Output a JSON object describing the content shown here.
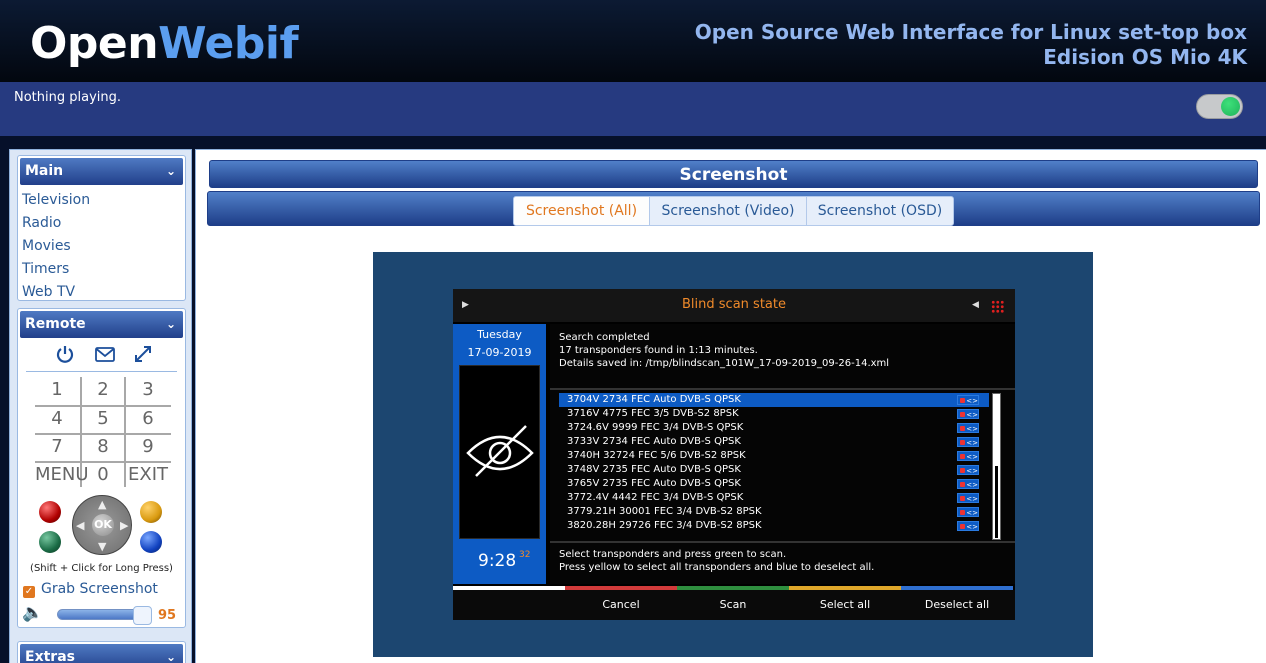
{
  "header": {
    "logo_part1": "Open",
    "logo_part2": "Webif",
    "subtitle_line1": "Open Source Web Interface for Linux set-top box",
    "subtitle_line2": "Edision OS Mio 4K"
  },
  "status": {
    "now_playing": "Nothing playing.",
    "toggle_on": true,
    "toggle_color": "#1eb35a"
  },
  "sidebar": {
    "main": {
      "title": "Main",
      "items": [
        "Television",
        "Radio",
        "Movies",
        "Timers",
        "Web TV"
      ]
    },
    "remote": {
      "title": "Remote",
      "icons": [
        "power-icon",
        "envelope-icon",
        "expand-icon"
      ],
      "keys": [
        "1",
        "2",
        "3",
        "4",
        "5",
        "6",
        "7",
        "8",
        "9",
        "MENU",
        "0",
        "EXIT"
      ],
      "ok_label": "OK",
      "long_press_hint": "(Shift + Click for Long Press)",
      "grab_screenshot_label": "Grab Screenshot",
      "grab_screenshot_checked": true,
      "volume": "95"
    },
    "extras": {
      "title": "Extras"
    }
  },
  "content": {
    "title": "Screenshot",
    "tabs": [
      "Screenshot (All)",
      "Screenshot (Video)",
      "Screenshot (OSD)"
    ],
    "active_tab": "Screenshot (All)"
  },
  "screenshot": {
    "title": "Blind scan state",
    "day": "Tuesday",
    "date": "17-09-2019",
    "time": "9:28",
    "seconds": "32",
    "messages": [
      "Search completed",
      "17 transponders found in 1:13 minutes.",
      "Details saved in: /tmp/blindscan_101W_17-09-2019_09-26-14.xml"
    ],
    "transponders": [
      "3704V 2734 FEC Auto DVB-S QPSK",
      "3716V 4775 FEC 3/5 DVB-S2 8PSK",
      "3724.6V 9999 FEC 3/4 DVB-S QPSK",
      "3733V 2734 FEC Auto DVB-S QPSK",
      "3740H 32724 FEC 5/6 DVB-S2 8PSK",
      "3748V 2735 FEC Auto DVB-S QPSK",
      "3765V 2735 FEC Auto DVB-S QPSK",
      "3772.4V 4442 FEC 3/4 DVB-S QPSK",
      "3779.21H 30001 FEC 3/4 DVB-S2 8PSK",
      "3820.28H 29726 FEC 3/4 DVB-S2 8PSK"
    ],
    "transponder_badge": "<>",
    "hint_lines": [
      "Select transponders and press green to scan.",
      "Press yellow to select all transponders and blue to deselect all."
    ],
    "softkeys": [
      "Cancel",
      "Scan",
      "Select all",
      "Deselect all"
    ],
    "strip_colors": [
      "#ffffff",
      "#d23b3b",
      "#2f8f3f",
      "#e0a72a",
      "#2f6fd0"
    ]
  }
}
